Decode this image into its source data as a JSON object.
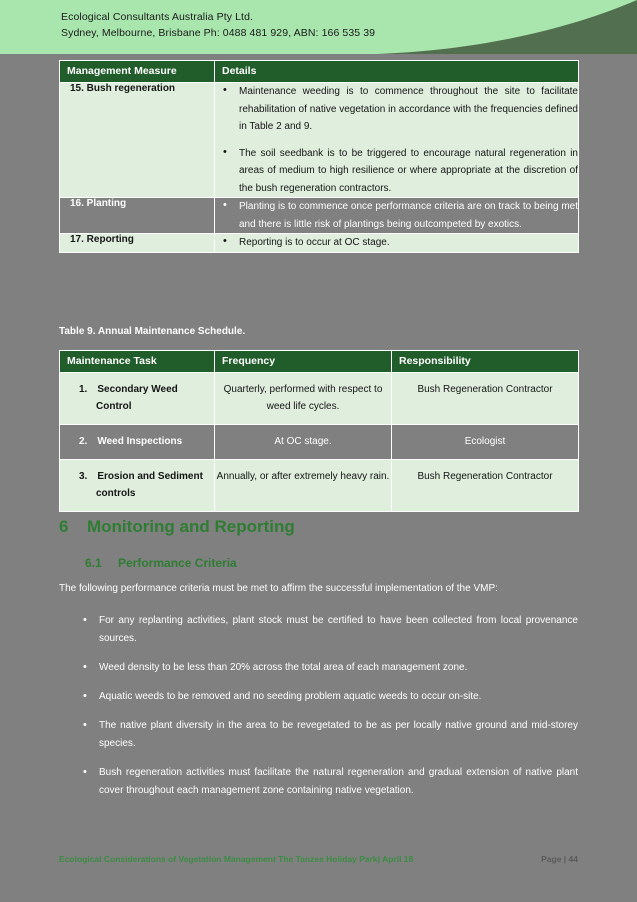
{
  "header": {
    "company": "Ecological Consultants Australia Pty Ltd.",
    "contact": "Sydney, Melbourne, Brisbane Ph: 0488 481 929, ABN: 166 535 39",
    "band_color": "#a9e6ae",
    "swoosh_color": "#52704f"
  },
  "tables": {
    "management_measures": {
      "columns": [
        "Management Measure",
        "Details"
      ],
      "rows": [
        {
          "measure": "15. Bush regeneration",
          "selected": false,
          "details": [
            "Maintenance weeding is to commence throughout the site to facilitate rehabilitation of native vegetation in accordance with the frequencies defined in Table 2 and 9.",
            "The soil seedbank is to be triggered to encourage natural regeneration in areas of medium to high resilience or where appropriate at the discretion of the bush regeneration contractors."
          ]
        },
        {
          "measure": "16. Planting",
          "selected": true,
          "details": [
            "Planting is to commence once performance criteria are on track to being met and there is little risk of plantings being outcompeted by exotics."
          ]
        },
        {
          "measure": "17. Reporting",
          "selected": false,
          "details": [
            "Reporting is to occur at OC stage."
          ]
        }
      ]
    },
    "maintenance_schedule": {
      "caption": "Table 9. Annual Maintenance Schedule.",
      "columns": [
        "Maintenance Task",
        "Frequency",
        "Responsibility"
      ],
      "rows": [
        {
          "task": "1. Secondary Weed Control",
          "frequency": "Quarterly, performed with respect to weed life cycles.",
          "responsibility": "Bush Regeneration Contractor",
          "selected": false
        },
        {
          "task": "2. Weed Inspections",
          "frequency": "At OC stage.",
          "responsibility": "Ecologist",
          "selected": true
        },
        {
          "task": "3. Erosion and Sediment controls",
          "frequency": "Annually, or after extremely heavy rain.",
          "responsibility": "Bush Regeneration Contractor",
          "selected": false
        }
      ]
    }
  },
  "section": {
    "heading_number": "6",
    "heading_title": "Monitoring and Reporting",
    "sub_number": "6.1",
    "sub_title": "Performance Criteria",
    "intro": "The following performance criteria must be met to affirm the successful implementation of the VMP:",
    "criteria": [
      "For any replanting activities, plant stock must be certified to have been collected from local provenance sources.",
      "Weed density to be less than 20% across the total area of each management zone.",
      "Aquatic weeds to be removed and no seeding problem aquatic weeds to occur on-site.",
      "The native plant diversity in the area to be revegetated to be as per locally native ground and mid-storey species.",
      "Bush regeneration activities must facilitate the natural regeneration and gradual extension of native plant cover throughout each management zone containing native vegetation."
    ]
  },
  "footer": {
    "document_title": "Ecological Considerations of Vegetation Management The Tanzee Holiday Park| April 18",
    "page_label": "Page | 44"
  },
  "colors": {
    "table_header": "#215c2b",
    "table_cell": "#dfeedd",
    "selection": "#808080",
    "heading_green": "#2e7d33",
    "footer_green": "#3c8c43"
  }
}
